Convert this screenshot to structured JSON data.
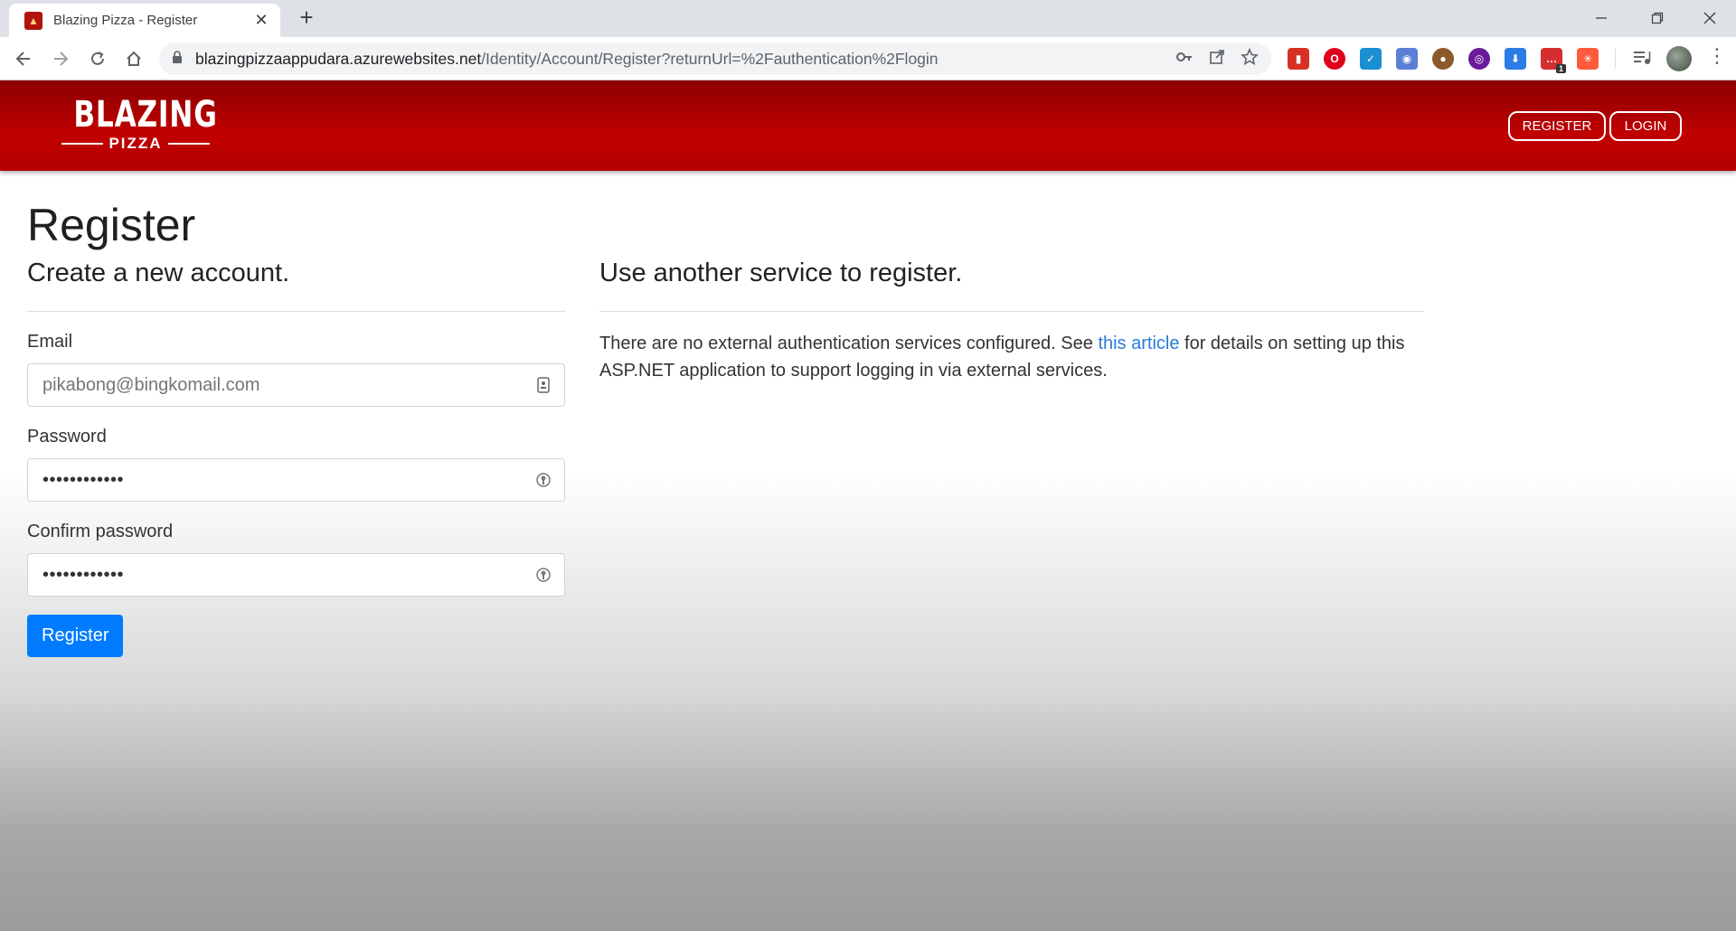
{
  "browser": {
    "tab_title": "Blazing Pizza - Register",
    "tab_favicon_glyph": "▲",
    "new_tab_label": "+",
    "close_tab_glyph": "✕",
    "url_host": "blazingpizzaappudara.azurewebsites.net",
    "url_path": "/Identity/Account/Register?returnUrl=%2Fauthentication%2Flogin",
    "extensions": [
      {
        "name": "bookmark-extension-icon",
        "color": "#d93025",
        "glyph": "▮"
      },
      {
        "name": "opera-extension-icon",
        "color": "#e0001b",
        "glyph": "O"
      },
      {
        "name": "checkbox-extension-icon",
        "color": "#1a8fd1",
        "glyph": "✓"
      },
      {
        "name": "camera-extension-icon",
        "color": "#5a7fd6",
        "glyph": "◉"
      },
      {
        "name": "cookie-extension-icon",
        "color": "#8a5a2b",
        "glyph": "●"
      },
      {
        "name": "color-picker-extension-icon",
        "color": "#6a1b9a",
        "glyph": "◎"
      },
      {
        "name": "download-extension-icon",
        "color": "#2d7be5",
        "glyph": "⬇"
      },
      {
        "name": "messages-extension-icon",
        "color": "#d32f2f",
        "glyph": "…",
        "badge": "1"
      },
      {
        "name": "network-extension-icon",
        "color": "#ff5a3c",
        "glyph": "✳"
      }
    ]
  },
  "header": {
    "logo_top": "BLAZING",
    "logo_bottom": "PIZZA",
    "register_label": "REGISTER",
    "login_label": "LOGIN"
  },
  "page": {
    "title": "Register",
    "left_heading": "Create a new account.",
    "right_heading": "Use another service to register.",
    "email_label": "Email",
    "email_placeholder": "pikabong@bingkomail.com",
    "password_label": "Password",
    "password_dots": "••••••••••••",
    "confirm_label": "Confirm password",
    "confirm_dots": "••••••••••••",
    "submit_label": "Register",
    "info_before": "There are no external authentication services configured. See ",
    "info_link": "this article",
    "info_after": " for details on setting up this ASP.NET application to support logging in via external services."
  }
}
